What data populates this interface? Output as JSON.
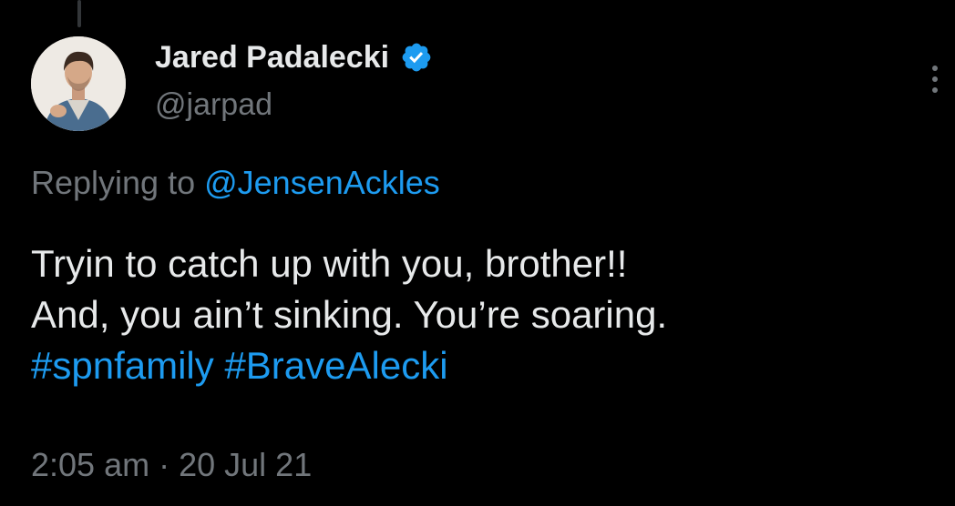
{
  "tweet": {
    "author": {
      "display_name": "Jared Padalecki",
      "handle": "@jarpad",
      "verified_icon": "verified-badge-icon"
    },
    "reply": {
      "prefix": "Replying to ",
      "mention": "@JensenAckles"
    },
    "text_lines": [
      "Tryin to catch up with you, brother!!",
      "And, you ain’t sinking. You’re soaring."
    ],
    "hashtags": [
      "#spnfamily",
      "#BraveAlecki"
    ],
    "time": "2:05 am",
    "separator": "·",
    "date": "20 Jul 21"
  },
  "colors": {
    "background": "#000000",
    "primary_text": "#e7e9ea",
    "secondary_text": "#71767b",
    "link": "#1d9bf0"
  },
  "icons": {
    "more": "more-options-icon"
  }
}
